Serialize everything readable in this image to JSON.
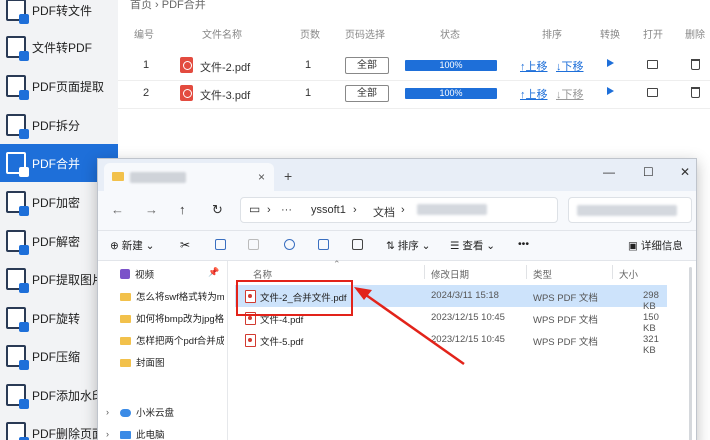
{
  "sidebar": {
    "items": [
      {
        "label": "PDF转文件"
      },
      {
        "label": "文件转PDF"
      },
      {
        "label": "PDF页面提取"
      },
      {
        "label": "PDF拆分"
      },
      {
        "label": "PDF合并",
        "active": true
      },
      {
        "label": "PDF加密"
      },
      {
        "label": "PDF解密"
      },
      {
        "label": "PDF提取图片"
      },
      {
        "label": "PDF旋转"
      },
      {
        "label": "PDF压缩"
      },
      {
        "label": "PDF添加水印"
      },
      {
        "label": "PDF删除页面"
      }
    ]
  },
  "breadcrumb": "首页 › PDF合并",
  "table": {
    "headers": {
      "index": "编号",
      "name": "文件名称",
      "pages": "页数",
      "page_select": "页码选择",
      "status": "状态",
      "order": "排序",
      "convert": "转换",
      "open": "打开",
      "delete": "删除"
    },
    "rows": [
      {
        "index": "1",
        "name": "文件-2.pdf",
        "pages": "1",
        "page_select": "全部",
        "progress": "100%",
        "up": "上移",
        "down": "下移"
      },
      {
        "index": "2",
        "name": "文件-3.pdf",
        "pages": "1",
        "page_select": "全部",
        "progress": "100%",
        "up": "上移",
        "down": "下移"
      }
    ]
  },
  "explorer": {
    "tab_close": "×",
    "tab_add": "+",
    "window_controls": {
      "minimize": "—",
      "maximize": "☐",
      "close": "✕"
    },
    "address": {
      "segment1": "yssoft1",
      "segment2": "文档"
    },
    "commands": {
      "new": "新建",
      "sort": "排序",
      "view": "查看",
      "more": "•••",
      "details": "详细信息"
    },
    "nav_items": [
      {
        "label": "视频",
        "type": "video"
      },
      {
        "label": "怎么将swf格式转为mp",
        "type": "folder"
      },
      {
        "label": "如何将bmp改为jpg格",
        "type": "folder"
      },
      {
        "label": "怎样把两个pdf合并成",
        "type": "folder"
      },
      {
        "label": "封面图",
        "type": "folder"
      },
      {
        "label": "小米云盘",
        "type": "cloud"
      },
      {
        "label": "此电脑",
        "type": "pc"
      }
    ],
    "columns": {
      "name": "名称",
      "modified": "修改日期",
      "type": "类型",
      "size": "大小"
    },
    "files": [
      {
        "name": "文件-2_合并文件.pdf",
        "modified": "2024/3/11 15:18",
        "type": "WPS PDF 文档",
        "size": "298 KB",
        "selected": true
      },
      {
        "name": "文件-4.pdf",
        "modified": "2023/12/15 10:45",
        "type": "WPS PDF 文档",
        "size": "150 KB"
      },
      {
        "name": "文件-5.pdf",
        "modified": "2023/12/15 10:45",
        "type": "WPS PDF 文档",
        "size": "321 KB"
      }
    ]
  },
  "colors": {
    "accent": "#1e6fd9",
    "annotation": "#e2231a",
    "selection": "#cde3fb"
  }
}
